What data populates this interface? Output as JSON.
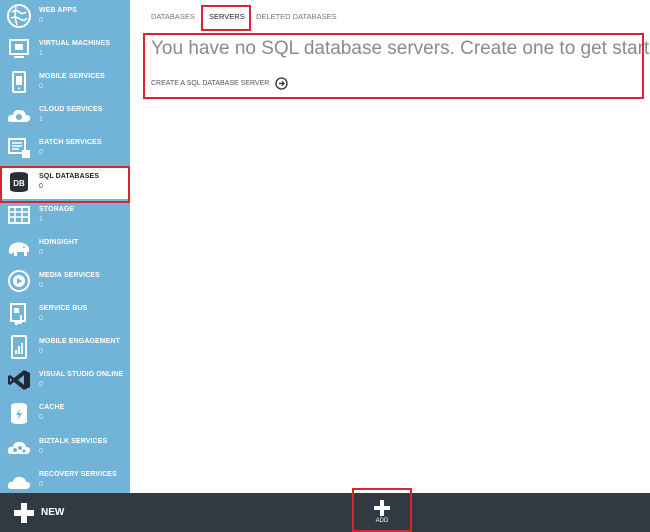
{
  "sidebar": {
    "items": [
      {
        "label": "WEB APPS",
        "count": "0"
      },
      {
        "label": "VIRTUAL MACHINES",
        "count": "1"
      },
      {
        "label": "MOBILE SERVICES",
        "count": "0"
      },
      {
        "label": "CLOUD SERVICES",
        "count": "1"
      },
      {
        "label": "BATCH SERVICES",
        "count": "0"
      },
      {
        "label": "SQL DATABASES",
        "count": "0",
        "icon_text": "DB"
      },
      {
        "label": "STORAGE",
        "count": "1"
      },
      {
        "label": "HDINSIGHT",
        "count": "0"
      },
      {
        "label": "MEDIA SERVICES",
        "count": "0"
      },
      {
        "label": "SERVICE BUS",
        "count": "0"
      },
      {
        "label": "MOBILE ENGAGEMENT",
        "count": "0"
      },
      {
        "label": "VISUAL STUDIO ONLINE",
        "count": "0"
      },
      {
        "label": "CACHE",
        "count": "0"
      },
      {
        "label": "BIZTALK SERVICES",
        "count": "0"
      },
      {
        "label": "RECOVERY SERVICES",
        "count": "0"
      }
    ]
  },
  "tabs": [
    {
      "label": "DATABASES"
    },
    {
      "label": "SERVERS"
    },
    {
      "label": "DELETED DATABASES"
    }
  ],
  "main": {
    "empty_title": "You have no SQL database servers. Create one to get started!",
    "create_link": "CREATE A SQL DATABASE SERVER"
  },
  "bottombar": {
    "new_label": "NEW",
    "add_label": "ADD"
  },
  "colors": {
    "sidebar": "#72b3d8",
    "bottombar": "#313a42",
    "highlight": "#d9252f"
  }
}
